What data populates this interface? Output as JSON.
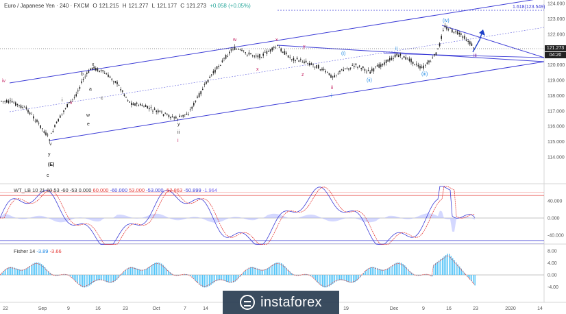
{
  "header": {
    "symbol": "Euro / Japanese Yen · 240 · FXCM",
    "o_label": "O",
    "o": "121.215",
    "h_label": "H",
    "h": "121.277",
    "l_label": "L",
    "l": "121.177",
    "c_label": "C",
    "c": "121.273",
    "change": "+0.058 (+0.05%)"
  },
  "price_axis": {
    "ticks": [
      "124.000",
      "123.000",
      "122.000",
      "121.000",
      "120.000",
      "119.000",
      "118.000",
      "117.000",
      "116.000",
      "115.000",
      "114.000"
    ],
    "last_price": "121.273",
    "countdown": "04:20"
  },
  "annotations": {
    "fib_label": "1.618(123.549)",
    "waves": [
      {
        "text": "iv",
        "color": "#c2185b"
      },
      {
        "text": "i",
        "color": "#222"
      },
      {
        "text": "b",
        "color": "#222"
      },
      {
        "text": "x",
        "color": "#222"
      },
      {
        "text": "a",
        "color": "#222"
      },
      {
        "text": "c",
        "color": "#222"
      },
      {
        "text": "w",
        "color": "#222"
      },
      {
        "text": "e",
        "color": "#222"
      },
      {
        "text": "v",
        "color": "#c2185b"
      },
      {
        "text": "v",
        "color": "#222"
      },
      {
        "text": "y",
        "color": "#222"
      },
      {
        "text": "(E)",
        "color": "#222"
      },
      {
        "text": "c",
        "color": "#222"
      },
      {
        "text": "y",
        "color": "#222"
      },
      {
        "text": "ii",
        "color": "#222"
      },
      {
        "text": "i",
        "color": "#c2185b"
      },
      {
        "text": "w",
        "color": "#c2185b"
      },
      {
        "text": "x",
        "color": "#c2185b"
      },
      {
        "text": "x",
        "color": "#c2185b"
      },
      {
        "text": "y",
        "color": "#c2185b"
      },
      {
        "text": "z",
        "color": "#c2185b"
      },
      {
        "text": "ii",
        "color": "#c2185b"
      },
      {
        "text": "i",
        "color": "#1e88e5"
      },
      {
        "text": "(i)",
        "color": "#1e88e5"
      },
      {
        "text": "ii",
        "color": "#1e88e5"
      },
      {
        "text": "(ii)",
        "color": "#1e88e5"
      },
      {
        "text": "(iii)",
        "color": "#1e88e5"
      },
      {
        "text": "(iv)",
        "color": "#1e88e5"
      },
      {
        "text": "iii",
        "color": "#7b1fa2"
      }
    ]
  },
  "wt_panel": {
    "title": "WT_LB 10 21 60 53 -60 -53",
    "values": [
      "0.000",
      "60.000",
      "-60.000",
      "53.000",
      "-53.000",
      "-52.863",
      "-50.899",
      "-1.964"
    ],
    "ticks": [
      "40.000",
      "0.000",
      "-40.000"
    ]
  },
  "fisher_panel": {
    "title": "Fisher 14",
    "values": [
      "-3.89",
      "-3.66"
    ],
    "ticks": [
      "8.00",
      "4.00",
      "0.00",
      "-4.00"
    ]
  },
  "time_axis": [
    "22",
    "Sep",
    "9",
    "16",
    "23",
    "Oct",
    "7",
    "14",
    "19",
    "Dec",
    "9",
    "16",
    "23",
    "2020",
    "14"
  ],
  "watermark": "instaforex",
  "colors": {
    "candle": "#222222",
    "channel": "#3b3bd6",
    "wt_main": "#e53935",
    "wt_signal": "#3b3bd6",
    "fisher_hist": "#4fc3f7",
    "price_tag": "#222222",
    "countdown_tag": "#222222"
  },
  "chart_data": [
    {
      "type": "line",
      "name_note": "",
      "x": [
        "22",
        "Sep",
        "9",
        "16",
        "23",
        "Oct",
        "7",
        "14",
        "19",
        "Dec",
        "9",
        "16",
        "23"
      ],
      "series": [
        {
          "values": [
            118.2,
            116.0,
            119.9,
            118.0,
            118.2,
            117.1,
            121.3,
            121.2,
            119.3,
            120.9,
            120.1,
            122.8,
            121.3
          ]
        }
      ],
      "ylim": [
        113.5,
        124.2
      ]
    },
    {
      "type": "line",
      "ylim": [
        -60,
        80
      ],
      "series": [
        {
          "values": [
            0,
            -45,
            60,
            -40,
            40,
            -35,
            60,
            -40,
            -55,
            50,
            -30,
            75,
            -50
          ]
        }
      ]
    },
    {
      "type": "bar",
      "ylim": [
        -5,
        9
      ],
      "series": [
        {
          "values": [
            0,
            -3,
            3,
            -2,
            2,
            -3,
            4,
            -2,
            -4,
            3,
            -2,
            7,
            -3.89
          ]
        }
      ]
    }
  ]
}
